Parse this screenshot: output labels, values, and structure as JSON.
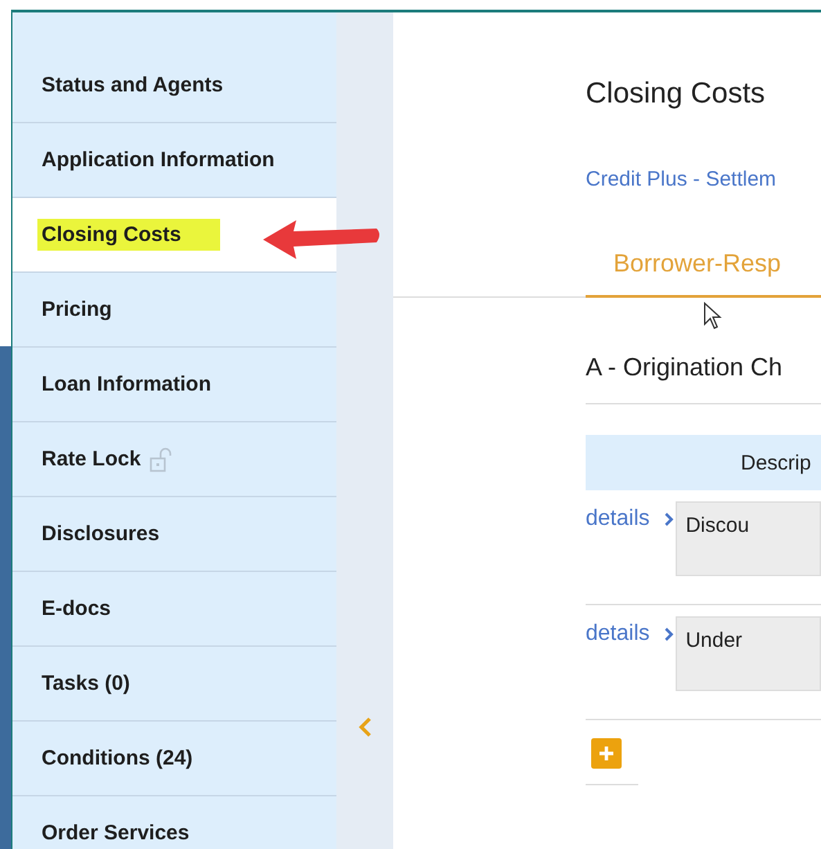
{
  "sidebar": {
    "items": [
      {
        "label": "Status and Agents",
        "selected": false,
        "highlighted": false
      },
      {
        "label": "Application Information",
        "selected": false,
        "highlighted": false
      },
      {
        "label": "Closing Costs",
        "selected": true,
        "highlighted": true
      },
      {
        "label": "Pricing",
        "selected": false,
        "highlighted": false
      },
      {
        "label": "Loan Information",
        "selected": false,
        "highlighted": false
      },
      {
        "label": "Rate Lock",
        "selected": false,
        "highlighted": false,
        "kind": "lock"
      },
      {
        "label": "Disclosures",
        "selected": false,
        "highlighted": false
      },
      {
        "label": "E-docs",
        "selected": false,
        "highlighted": false
      },
      {
        "label": "Tasks (0)",
        "selected": false,
        "highlighted": false
      },
      {
        "label": "Conditions (24)",
        "selected": false,
        "highlighted": false
      },
      {
        "label": "Order Services",
        "selected": false,
        "highlighted": false
      }
    ]
  },
  "main": {
    "title": "Closing Costs",
    "link": "Credit Plus - Settlem",
    "tabs": [
      {
        "label": "Borrower-Resp",
        "selected": true
      }
    ],
    "section": {
      "title": "A - Origination Ch",
      "table": {
        "columns": [
          "Descrip"
        ],
        "rows": [
          {
            "link": "details",
            "description": "Discou"
          },
          {
            "link": "details",
            "description": "Under"
          }
        ]
      }
    }
  }
}
